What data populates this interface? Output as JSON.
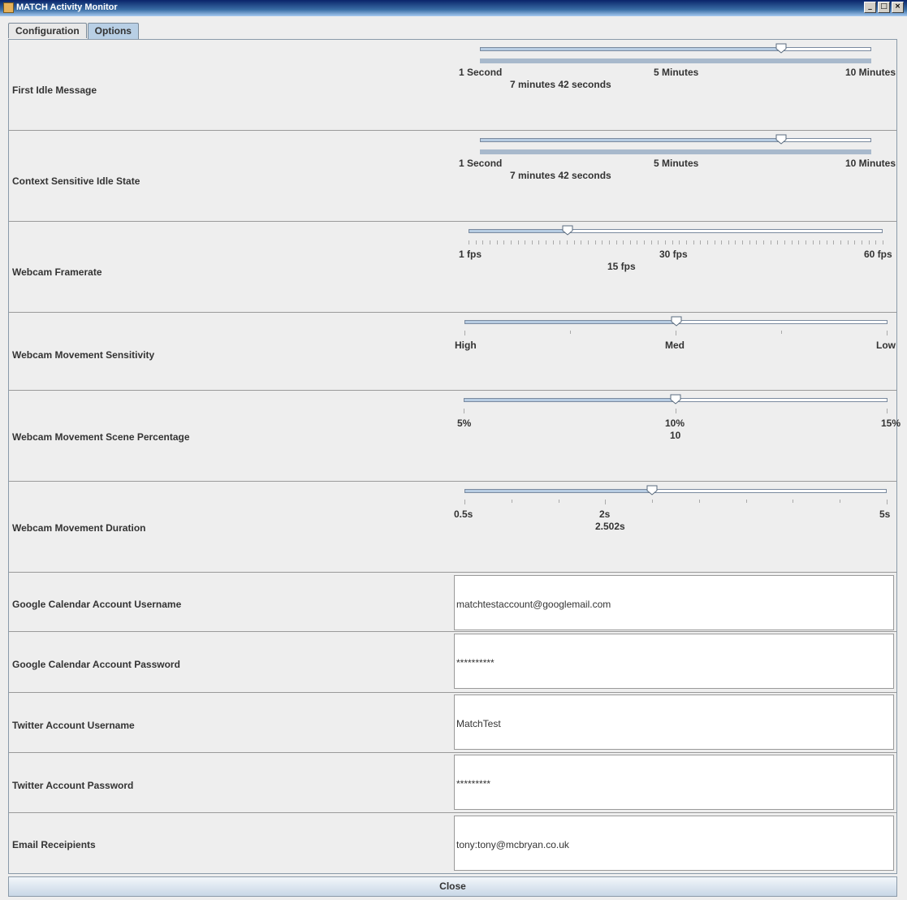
{
  "window": {
    "title": "MATCH Activity Monitor"
  },
  "tabs": [
    {
      "label": "Configuration"
    },
    {
      "label": "Options"
    }
  ],
  "sliders": [
    {
      "label": "First Idle Message",
      "min_label": "1 Second",
      "mid_label": "5 Minutes",
      "max_label": "10 Minutes",
      "value_text": "7 minutes 42 seconds",
      "fraction": 0.77
    },
    {
      "label": "Context Sensitive Idle State",
      "min_label": "1 Second",
      "mid_label": "5 Minutes",
      "max_label": "10 Minutes",
      "value_text": "7 minutes 42 seconds",
      "fraction": 0.77
    },
    {
      "label": "Webcam Framerate",
      "min_label": "1 fps",
      "mid_label": "30 fps",
      "max_label": "60 fps",
      "value_text": "15 fps",
      "fraction": 0.24
    },
    {
      "label": "Webcam Movement Sensitivity",
      "min_label": "High",
      "mid_label": "Med",
      "max_label": "Low",
      "value_text": "",
      "fraction": 0.5
    },
    {
      "label": "Webcam Movement Scene Percentage",
      "min_label": "5%",
      "mid_label": "10%",
      "max_label": "15%",
      "value_text": "10",
      "fraction": 0.5
    },
    {
      "label": "Webcam Movement Duration",
      "min_label": "0.5s",
      "mid_label": "2s",
      "max_label": "5s",
      "value_text": "2.502s",
      "fraction": 0.445
    }
  ],
  "fields": [
    {
      "label": "Google Calendar Account Username",
      "value": "matchtestaccount@googlemail.com"
    },
    {
      "label": "Google Calendar Account Password",
      "value": "**********"
    },
    {
      "label": "Twitter Account Username",
      "value": "MatchTest"
    },
    {
      "label": "Twitter Account Password",
      "value": "*********"
    },
    {
      "label": "Email Receipients",
      "value": "tony:tony@mcbryan.co.uk"
    }
  ],
  "footer": {
    "close_label": "Close"
  }
}
